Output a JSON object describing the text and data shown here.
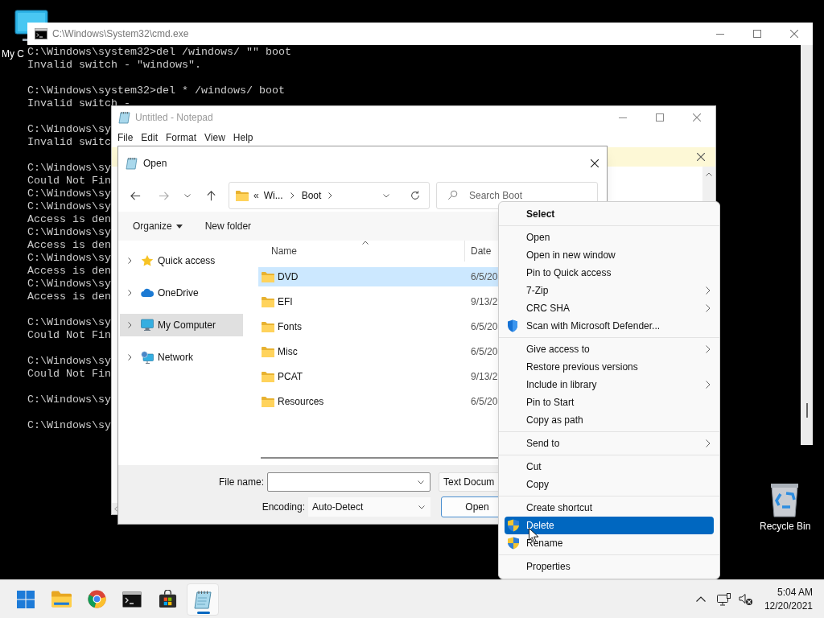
{
  "desktop_icons": [
    {
      "kind": "computer",
      "label": "My C"
    },
    {
      "kind": "recycle_bin",
      "label": "Recycle Bin"
    }
  ],
  "cmd_window": {
    "title": "C:\\Windows\\System32\\cmd.exe",
    "blocks": [
      [
        "C:\\Windows\\system32>del /windows/ \"\" boot",
        "Invalid switch - \"windows\"."
      ],
      [
        "C:\\Windows\\system32>del * /windows/ boot",
        "Invalid switch -"
      ],
      [
        "C:\\Windows\\sy",
        "Invalid switc"
      ],
      [
        "C:\\Windows\\sy",
        "Could Not Fin",
        "C:\\Windows\\sy",
        "C:\\Windows\\sy",
        "Access is den",
        "C:\\Windows\\sy",
        "Access is den",
        "C:\\Windows\\sy",
        "Access is den",
        "C:\\Windows\\sy",
        "Access is den"
      ],
      [
        "C:\\Windows\\sy",
        "Could Not Fin"
      ],
      [
        "C:\\Windows\\sy",
        "Could Not Fin"
      ],
      [
        "C:\\Windows\\sy"
      ],
      [
        "C:\\Windows\\sy"
      ]
    ]
  },
  "notepad_window": {
    "title": "Untitled - Notepad",
    "menu": [
      "File",
      "Edit",
      "Format",
      "View",
      "Help"
    ]
  },
  "open_dialog": {
    "title": "Open",
    "address": {
      "overflow": "«",
      "crumbs": [
        "Wi...",
        "Boot"
      ]
    },
    "search": {
      "placeholder": "Search Boot"
    },
    "toolbar": [
      {
        "label": "Organize",
        "dropdown": true
      },
      {
        "label": "New folder",
        "dropdown": false
      }
    ],
    "nav_items": [
      {
        "label": "Quick access",
        "kind": "star",
        "selected": false
      },
      {
        "label": "OneDrive",
        "kind": "cloud",
        "selected": false
      },
      {
        "label": "My Computer",
        "kind": "computer",
        "selected": true
      },
      {
        "label": "Network",
        "kind": "network",
        "selected": false
      }
    ],
    "columns": [
      "Name",
      "Date"
    ],
    "files": [
      {
        "name": "DVD",
        "date": "6/5/20",
        "selected": true
      },
      {
        "name": "EFI",
        "date": "9/13/2",
        "selected": false
      },
      {
        "name": "Fonts",
        "date": "6/5/20",
        "selected": false
      },
      {
        "name": "Misc",
        "date": "6/5/20",
        "selected": false
      },
      {
        "name": "PCAT",
        "date": "9/13/2",
        "selected": false
      },
      {
        "name": "Resources",
        "date": "6/5/20",
        "selected": false
      }
    ],
    "file_name": {
      "label": "File name:"
    },
    "file_type": "Text Docum",
    "encoding": {
      "label": "Encoding:",
      "value": "Auto-Detect"
    },
    "open_button": "Open"
  },
  "context_menu": {
    "sections": [
      [
        {
          "label": "Select",
          "kind": "header",
          "submenu": false,
          "selected": false
        }
      ],
      [
        {
          "label": "Open",
          "kind": "plain",
          "submenu": false,
          "selected": false
        },
        {
          "label": "Open in new window",
          "kind": "plain",
          "submenu": false,
          "selected": false
        },
        {
          "label": "Pin to Quick access",
          "kind": "plain",
          "submenu": false,
          "selected": false
        },
        {
          "label": "7-Zip",
          "kind": "plain",
          "submenu": true,
          "selected": false
        },
        {
          "label": "CRC SHA",
          "kind": "plain",
          "submenu": true,
          "selected": false
        },
        {
          "label": "Scan with Microsoft Defender...",
          "kind": "defender",
          "submenu": false,
          "selected": false
        }
      ],
      [
        {
          "label": "Give access to",
          "kind": "plain",
          "submenu": true,
          "selected": false
        },
        {
          "label": "Restore previous versions",
          "kind": "plain",
          "submenu": false,
          "selected": false
        },
        {
          "label": "Include in library",
          "kind": "plain",
          "submenu": true,
          "selected": false
        },
        {
          "label": "Pin to Start",
          "kind": "plain",
          "submenu": false,
          "selected": false
        },
        {
          "label": "Copy as path",
          "kind": "plain",
          "submenu": false,
          "selected": false
        }
      ],
      [
        {
          "label": "Send to",
          "kind": "plain",
          "submenu": true,
          "selected": false
        }
      ],
      [
        {
          "label": "Cut",
          "kind": "plain",
          "submenu": false,
          "selected": false
        },
        {
          "label": "Copy",
          "kind": "plain",
          "submenu": false,
          "selected": false
        }
      ],
      [
        {
          "label": "Create shortcut",
          "kind": "plain",
          "submenu": false,
          "selected": false
        },
        {
          "label": "Delete",
          "kind": "uac",
          "submenu": false,
          "selected": true
        },
        {
          "label": "Rename",
          "kind": "uac",
          "submenu": false,
          "selected": false
        }
      ],
      [
        {
          "label": "Properties",
          "kind": "plain",
          "submenu": false,
          "selected": false
        }
      ]
    ]
  },
  "taskbar": {
    "apps": [
      {
        "kind": "start",
        "selected": false
      },
      {
        "kind": "explorer",
        "selected": false
      },
      {
        "kind": "browser",
        "selected": false
      },
      {
        "kind": "terminal",
        "selected": false
      },
      {
        "kind": "store",
        "selected": false
      },
      {
        "kind": "notepad",
        "selected": true
      }
    ],
    "clock": {
      "time": "5:04 AM",
      "date": "12/20/2021"
    }
  }
}
